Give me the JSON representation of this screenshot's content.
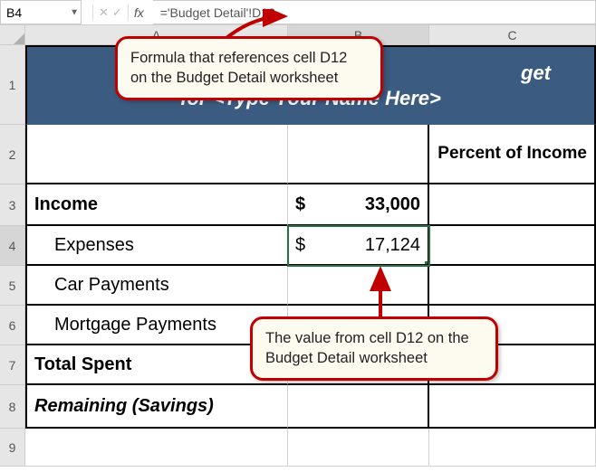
{
  "formula_bar": {
    "cell_ref": "B4",
    "cancel_icon": "✕",
    "accept_icon": "✓",
    "fx_label": "fx",
    "formula": "='Budget Detail'!D12"
  },
  "columns": {
    "A": "A",
    "B": "B",
    "C": "C"
  },
  "row_labels": [
    "1",
    "2",
    "3",
    "4",
    "5",
    "6",
    "7",
    "8",
    "9"
  ],
  "title_row": {
    "line_visible": "get",
    "full_line2": "for <Type Your Name Here>"
  },
  "header_row": {
    "A": "",
    "B": "",
    "C": "Percent of Income"
  },
  "rows": [
    {
      "A": "Income",
      "B_sym": "$",
      "B_val": "33,000",
      "C": "",
      "bold": true
    },
    {
      "A": "Expenses",
      "B_sym": "$",
      "B_val": "17,124",
      "C": "",
      "indent": true
    },
    {
      "A": "Car Payments",
      "B_sym": "",
      "B_val": "",
      "C": "",
      "indent": true
    },
    {
      "A": "Mortgage Payments",
      "B_sym": "",
      "B_val": "",
      "C": "",
      "indent": true
    },
    {
      "A": "Total Spent",
      "B_sym": "",
      "B_val": "",
      "C": "",
      "bold": true
    },
    {
      "A": "Remaining (Savings)",
      "B_sym": "",
      "B_val": "",
      "C": "",
      "bold": true,
      "italic": true
    }
  ],
  "callouts": {
    "top": "Formula that references cell D12 on the Budget Detail worksheet",
    "bottom": "The value from cell D12 on the Budget Detail worksheet"
  },
  "heights": {
    "r1": 88,
    "r2": 66,
    "r3": 46,
    "r4": 44,
    "r5": 44,
    "r6": 44,
    "r7": 44,
    "r8": 48,
    "r9": 42
  }
}
